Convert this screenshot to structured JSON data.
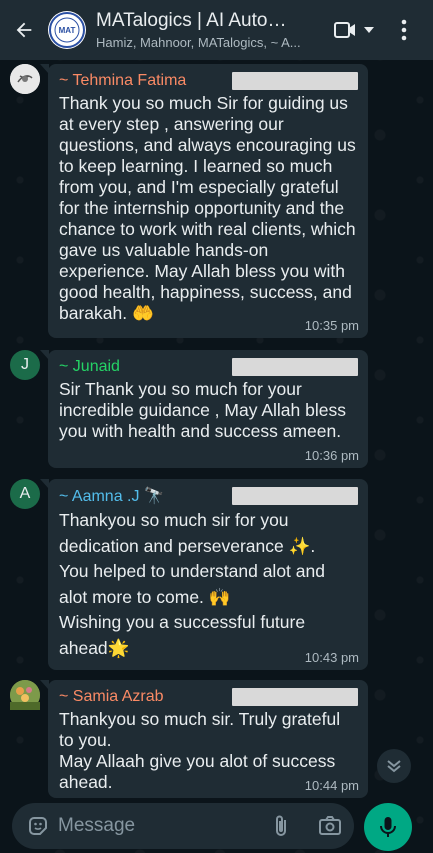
{
  "header": {
    "title": "MATalogics | AI Auto…",
    "subtitle": "Hamiz, Mahnoor, MATalogics, ~ A...",
    "avatar_text": "MAT"
  },
  "messages": [
    {
      "sender": "~ Tehmina Fatima",
      "sender_color": "#fa8a65",
      "avatar_kind": "photo",
      "text": "Thank you so much Sir for guiding us at every step ,  answering our questions, and always encouraging us to keep learning. I learned so much from you, and I'm especially grateful for the internship opportunity and the chance to work with real clients, which gave us valuable hands-on experience. May Allah bless you with good health, happiness, success, and barakah. 🤲",
      "time": "10:35 pm"
    },
    {
      "sender": "~ Junaid",
      "sender_color": "#25d366",
      "avatar_kind": "letter",
      "avatar_letter": "J",
      "text": "Sir Thank you so much for your incredible guidance , May Allah bless you with health and success ameen.",
      "time": "10:36 pm"
    },
    {
      "sender": "~ Aamna .J 🔭",
      "sender_color": "#53bdeb",
      "avatar_kind": "letter",
      "avatar_letter": "A",
      "text": "Thankyou so much sir for you dedication and perseverance ✨.\nYou helped to understand alot and alot more to come. 🙌\nWishing you a successful future ahead🌟",
      "time": "10:43 pm"
    },
    {
      "sender": "~ Samia Azrab",
      "sender_color": "#fa8a65",
      "avatar_kind": "photo",
      "text": "Thankyou so much sir. Truly grateful to you.\nMay Allaah give you alot of success ahead.",
      "time": "10:44 pm"
    }
  ],
  "composer": {
    "placeholder": "Message"
  },
  "colors": {
    "accent": "#00a884",
    "bubble": "#1f2c34",
    "background": "#0b141a"
  }
}
